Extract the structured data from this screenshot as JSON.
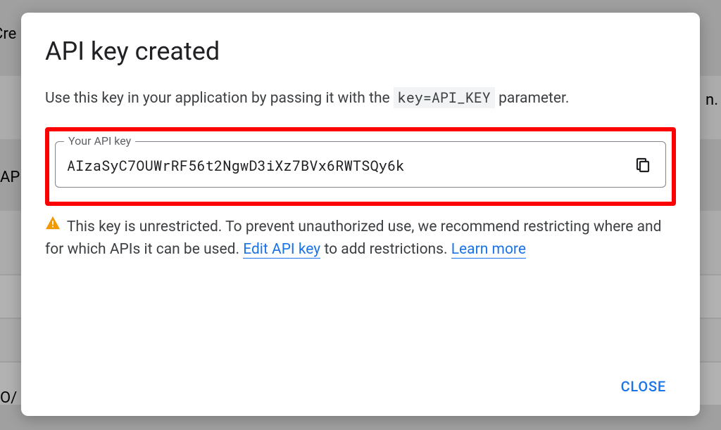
{
  "background": {
    "cre": "Cre",
    "ap": "AP",
    "o": "O/",
    "n": "n."
  },
  "modal": {
    "title": "API key created",
    "description_pre": "Use this key in your application by passing it with the ",
    "param": "key=API_KEY",
    "description_post": " parameter.",
    "field_label": "Your API key",
    "api_key": "AIzaSyC7OUWrRF56t2NgwD3iXz7BVx6RWTSQy6k",
    "warning_text_1": "This key is unrestricted. To prevent unauthorized use, we recommend restricting where and for which APIs it can be used. ",
    "edit_link": "Edit API key",
    "warning_text_2": " to add restrictions. ",
    "learn_more": "Learn more",
    "close_label": "CLOSE"
  }
}
